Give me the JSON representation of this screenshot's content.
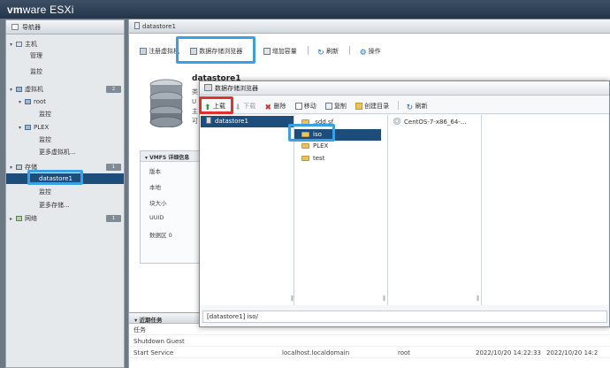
{
  "app": {
    "logo_vm": "vm",
    "logo_rest": "ware",
    "logo_product": "ESXi"
  },
  "nav": {
    "title": "导航器",
    "items": [
      {
        "label": "主机",
        "level": 0,
        "icon": "host-icon"
      },
      {
        "label": "管理",
        "level": 1
      },
      {
        "label": "监控",
        "level": 1
      },
      {
        "label": "虚拟机",
        "level": 0,
        "icon": "vm-icon",
        "count": "2"
      },
      {
        "label": "root",
        "level": 1,
        "icon": "vm-icon"
      },
      {
        "label": "监控",
        "level": 2
      },
      {
        "label": "PLEX",
        "level": 1,
        "icon": "vm-icon"
      },
      {
        "label": "监控",
        "level": 2
      },
      {
        "label": "更多虚拟机...",
        "level": 2
      },
      {
        "label": "存储",
        "level": 0,
        "icon": "storage-icon",
        "count": "1"
      },
      {
        "label": "datastore1",
        "level": 1,
        "selected": true
      },
      {
        "label": "监控",
        "level": 2
      },
      {
        "label": "更多存储...",
        "level": 2
      },
      {
        "label": "网络",
        "level": 0,
        "icon": "network-icon",
        "count": "1"
      }
    ]
  },
  "main": {
    "title": "datastore1",
    "toolbar": {
      "register_vm": "注册虚拟机",
      "datastore_browser": "数据存储浏览器",
      "increase_capacity": "增加容量",
      "refresh": "刷新",
      "actions": "操作"
    },
    "summary": {
      "name": "datastore1",
      "truncated_lines": [
        "类",
        "U",
        "主",
        "可"
      ]
    },
    "vmfs": {
      "header": "VMFS 详细信息",
      "rows": [
        "版本",
        "本地",
        "块大小",
        "UUID",
        "数据区 0"
      ]
    }
  },
  "tasks": {
    "header": "近期任务",
    "column_task": "任务",
    "rows": [
      {
        "task": "Shutdown Guest",
        "target": "",
        "initiator": "",
        "queued": "",
        "started": ""
      },
      {
        "task": "Start Service",
        "target": "localhost.localdomain",
        "initiator": "root",
        "queued": "2022/10/20 14:22:33",
        "started": "2022/10/20 14:2"
      }
    ]
  },
  "dialog": {
    "title": "数据存储浏览器",
    "toolbar": {
      "upload": "上载",
      "download": "下载",
      "delete": "删除",
      "move": "移动",
      "copy": "复制",
      "create_dir": "创建目录",
      "refresh": "刷新"
    },
    "pane1": [
      "datastore1"
    ],
    "pane2": [
      ".sdd.sf",
      "iso",
      "PLEX",
      "test"
    ],
    "pane2_selected": "iso",
    "pane3": [
      "CentOS-7-x86_64-..."
    ],
    "status_path": "[datastore1] iso/"
  },
  "colors": {
    "header_bg": "#23354a",
    "selection": "#1d4d7a",
    "highlight_blue": "#3aa0e6",
    "highlight_red": "#e0312b"
  }
}
